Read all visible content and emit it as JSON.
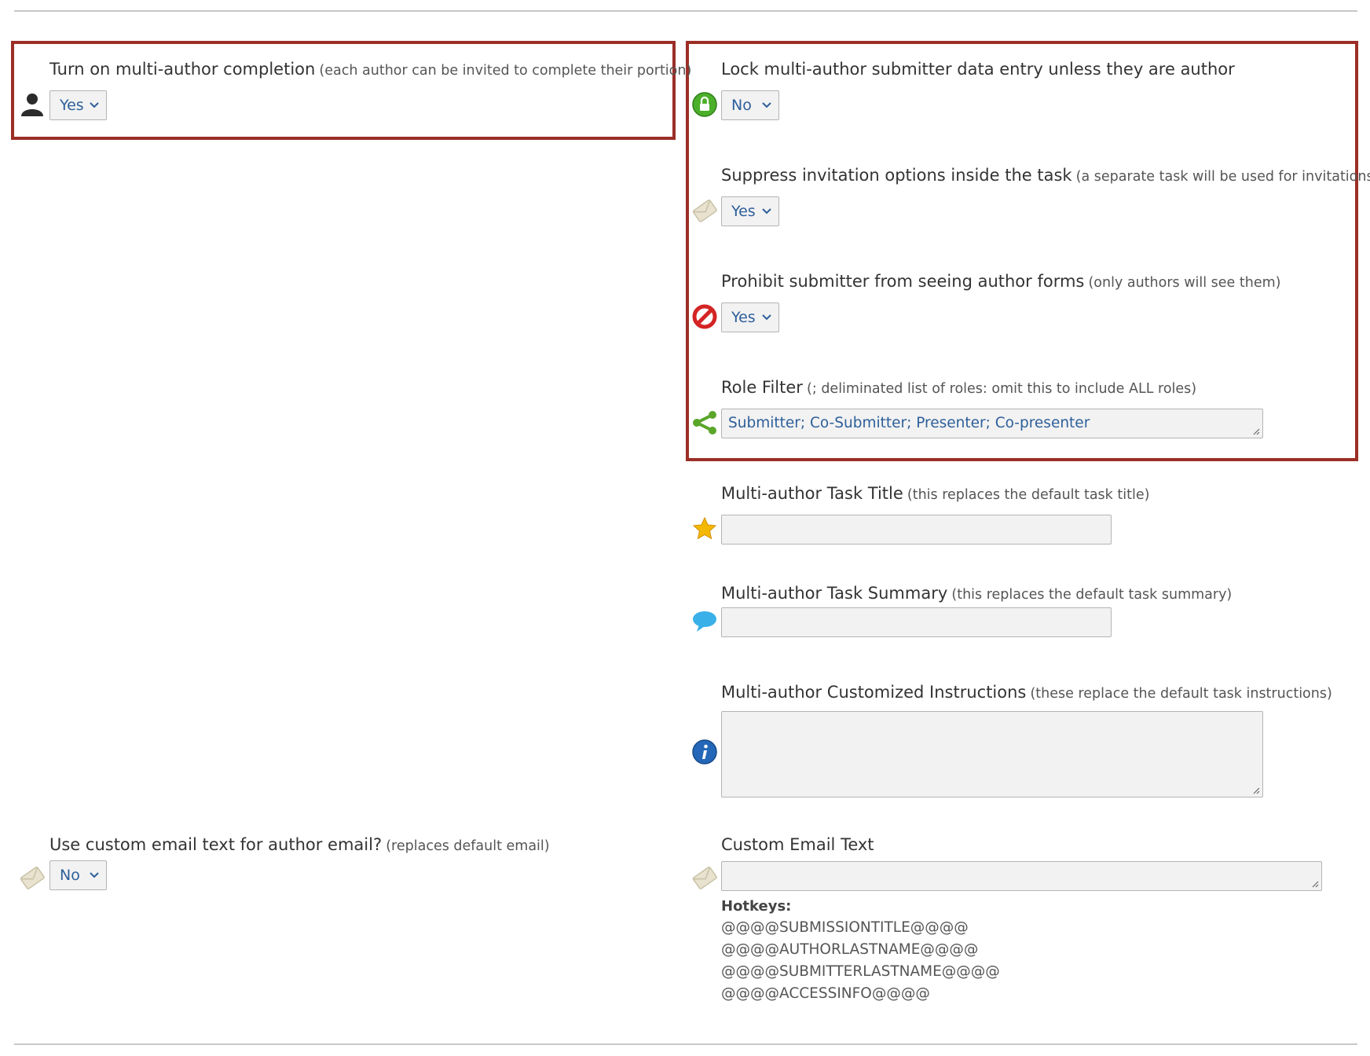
{
  "left": {
    "multi_author": {
      "label": "Turn on multi-author completion",
      "note": "(each author can be invited to complete their portion)",
      "value": "Yes",
      "icon": "person-icon"
    },
    "custom_email_toggle": {
      "label": "Use custom email text for author email?",
      "note": "(replaces default email)",
      "value": "No",
      "icon": "envelope-icon"
    }
  },
  "right": {
    "lock_entry": {
      "label": "Lock multi-author submitter data entry unless they are author",
      "note": "",
      "value": "No",
      "icon": "lock-icon"
    },
    "suppress_invites": {
      "label": "Suppress invitation options inside the task",
      "note": "(a separate task will be used for invitations)",
      "value": "Yes",
      "icon": "envelope-icon"
    },
    "prohibit_forms": {
      "label": "Prohibit submitter from seeing author forms",
      "note": "(only authors will see them)",
      "value": "Yes",
      "icon": "prohibited-icon"
    },
    "role_filter": {
      "label": "Role Filter",
      "note": "(; deliminated list of roles: omit this to include ALL roles)",
      "value": "Submitter; Co-Submitter; Presenter; Co-presenter",
      "icon": "share-icon"
    },
    "task_title": {
      "label": "Multi-author Task Title",
      "note": "(this replaces the default task title)",
      "value": "",
      "icon": "star-icon"
    },
    "task_summary": {
      "label": "Multi-author Task Summary",
      "note": "(this replaces the default task summary)",
      "value": "",
      "icon": "speech-bubble-icon"
    },
    "instructions": {
      "label": "Multi-author Customized Instructions",
      "note": "(these replace the default task instructions)",
      "value": "",
      "icon": "info-icon"
    },
    "custom_email_text": {
      "label": "Custom Email Text",
      "value": "",
      "icon": "envelope-icon",
      "hotkeys_title": "Hotkeys:",
      "hotkeys": [
        "@@@@SUBMISSIONTITLE@@@@",
        "@@@@AUTHORLASTNAME@@@@",
        "@@@@SUBMITTERLASTNAME@@@@",
        "@@@@ACCESSINFO@@@@"
      ]
    }
  },
  "colors": {
    "highlight_border": "#9b2e26",
    "link_text": "#2d5f9a",
    "input_bg": "#f2f2f2"
  }
}
